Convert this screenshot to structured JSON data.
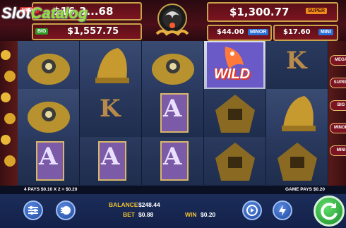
{
  "logo": {
    "text": "SlotCatalog",
    "slot": "Slot",
    "catalog": "Catalog"
  },
  "jackpots": {
    "mega": {
      "tag": "MEGA",
      "value": "$16,3...68"
    },
    "major_top": {
      "value": "$1,557.75",
      "tag": "BIG"
    },
    "super": {
      "value": "$1,300.77",
      "tag": "SUPER"
    },
    "minor": {
      "value": "$44.00",
      "tag": "MINOR"
    },
    "mini": {
      "value": "$17.60",
      "tag": "MINI"
    }
  },
  "reels": {
    "wild_label": "WILD",
    "letters": {
      "k": "K",
      "a": "A"
    }
  },
  "side": {
    "right_pills": [
      "MEGA",
      "SUPER",
      "BIG",
      "MINOR",
      "MINI"
    ]
  },
  "strip": {
    "left": "4  PAYS $0.10 X 2 = $0.20",
    "right": "GAME PAYS $0.20"
  },
  "bottom": {
    "balance_label": "BALANCE",
    "balance_value": "$248.44",
    "bet_label": "BET",
    "bet_value": "$0.88",
    "win_label": "WIN",
    "win_value": "$0.20"
  },
  "colors": {
    "accent_gold": "#f2c230",
    "wild_red": "#e03a2a",
    "spin_green": "#2fae3a"
  }
}
